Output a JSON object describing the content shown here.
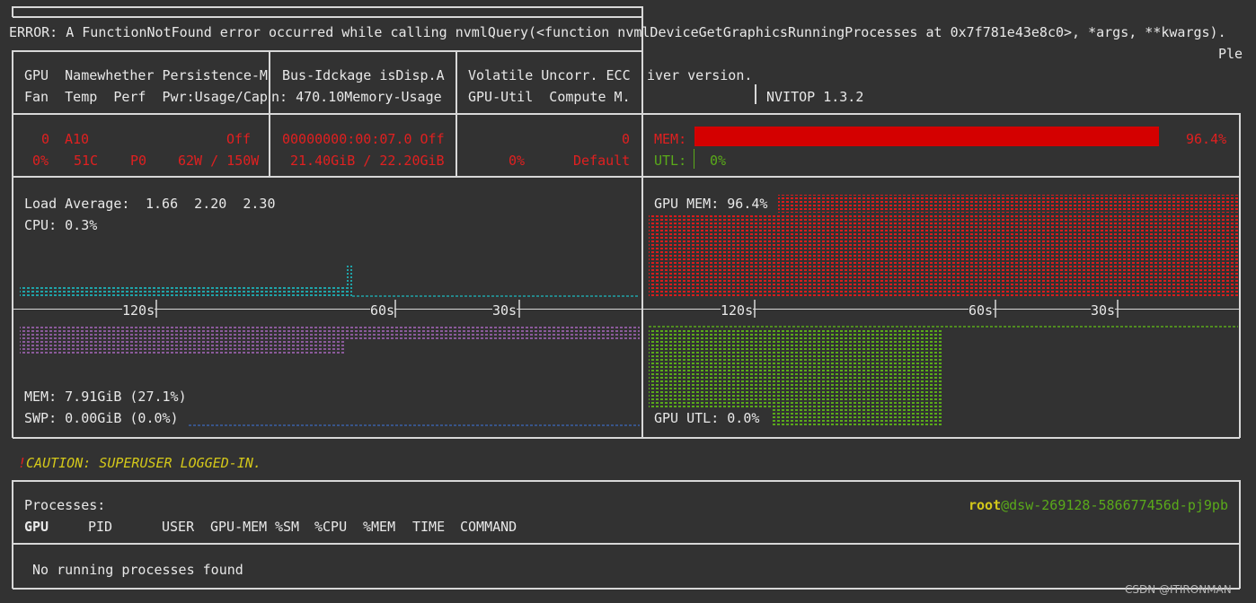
{
  "error": {
    "line": "ERROR: A FunctionNotFound error occurred while calling nvmlQuery(<function nvmlDeviceGetGraphicsRunningProcesses at 0x7f781e43e8c0>, *args, **kwargs).",
    "trailing": "Ple"
  },
  "header": {
    "col1_line1": "GPU  Namewhether Persistence-M",
    "col1_line2": "Fan  Temp  Perf  Pwr:Usage/Cap",
    "col2_line1": "Bus-Idckage isDisp.A",
    "col2_line2": "n: 470.10Memory-Usage",
    "col3_line1": "Volatile Uncorr. ECC",
    "col3_line2": "GPU-Util  Compute M.",
    "col4_line1": "iver version.",
    "nvitop": "NVITOP 1.3.2"
  },
  "gpu": {
    "index": "0",
    "name": "A10",
    "persistence": "Off",
    "fan": "0%",
    "temp": "51C",
    "perf": "P0",
    "power": "62W / 150W",
    "bus_id": "00000000:00:07.0 Off",
    "memory_usage": "21.40GiB / 22.20GiB",
    "ecc": "0",
    "gpu_util": "0%",
    "compute_mode": "Default",
    "mem_label": "MEM:",
    "mem_percent_text": "96.4%",
    "mem_fraction": 0.964,
    "utl_label": "UTL:",
    "utl_percent_text": "0%"
  },
  "host": {
    "load_label": "Load Average:",
    "load_values": "1.66  2.20  2.30",
    "cpu": "CPU: 0.3%",
    "mem": "MEM: 7.91GiB (27.1%)",
    "swp": "SWP: 0.00GiB (0.0%)",
    "gpu_mem": "GPU MEM: 96.4%",
    "gpu_utl": "GPU UTL: 0.0%"
  },
  "timeline": {
    "left_ticks": [
      "120s",
      "60s",
      "30s"
    ],
    "right_ticks": [
      "120s",
      "60s",
      "30s"
    ]
  },
  "caution": "!CAUTION: SUPERUSER LOGGED-IN.",
  "processes": {
    "title": "Processes:",
    "user_host": "root@dsw-269128-586677456d-pj9pb",
    "user": "root",
    "host": "@dsw-269128-586677456d-pj9pb",
    "columns": [
      "GPU",
      "PID",
      "USER",
      "GPU-MEM",
      "%SM",
      "%CPU",
      "%MEM",
      "TIME",
      "COMMAND"
    ],
    "empty_message": "No running processes found"
  },
  "watermark": "CSDN @ITIRONMAN",
  "colors": {
    "background": "#323232",
    "red": "#e02020",
    "green": "#5aaa1a",
    "cyan": "#1fa3a8",
    "purple": "#8a5a9a",
    "blue": "#3a5fa8",
    "yellow": "#d4c81a"
  }
}
